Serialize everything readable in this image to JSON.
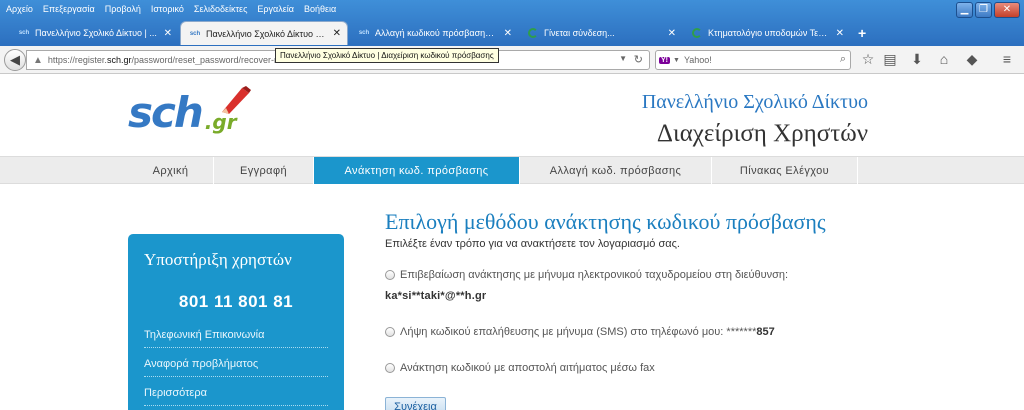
{
  "menubar": [
    "Αρχείο",
    "Επεξεργασία",
    "Προβολή",
    "Ιστορικό",
    "Σελιδοδείκτες",
    "Εργαλεία",
    "Βοήθεια"
  ],
  "window_controls": {
    "minimize": "▁",
    "maximize": "❐",
    "close": "✕"
  },
  "tabs": [
    {
      "title": "Πανελλήνιο Σχολικό Δίκτυο | ...",
      "favicon": "sch",
      "close": "✕"
    },
    {
      "title": "Πανελλήνιο Σχολικό Δίκτυο | ...",
      "favicon": "sch",
      "close": "✕"
    },
    {
      "title": "Αλλαγή κωδικού πρόσβασης - ...",
      "favicon": "sch",
      "close": "✕"
    },
    {
      "title": "Γίνεται σύνδεση...",
      "favicon": "loading-spinner",
      "close": "✕"
    },
    {
      "title": "Κτηματολόγιο υποδομών Τεχ...",
      "favicon": "loading-spinner",
      "close": "✕"
    }
  ],
  "new_tab": "+",
  "tooltip": "Πανελλήνιο Σχολικό Δίκτυο | Διαχείριση κωδικού πρόσβασης",
  "address_bar": {
    "prefix": "https://register.",
    "domain": "sch.gr",
    "suffix": "/password/reset_password/recover-m..."
  },
  "search_bar": {
    "engine": "Y!",
    "placeholder": "Yahoo!"
  },
  "site_header": {
    "logo_main": "sch",
    "logo_suffix": ".gr",
    "line1": "Πανελλήνιο Σχολικό Δίκτυο",
    "line2": "Διαχείριση Χρηστών"
  },
  "nav": [
    {
      "label": "Αρχική"
    },
    {
      "label": "Εγγραφή"
    },
    {
      "label": "Ανάκτηση κωδ. πρόσβασης",
      "active": true
    },
    {
      "label": "Αλλαγή κωδ. πρόσβασης"
    },
    {
      "label": "Πίνακας Ελέγχου"
    }
  ],
  "sidebar": {
    "title": "Υποστήριξη χρηστών",
    "phone": "801 11 801 81",
    "links": [
      "Τηλεφωνική Επικοινωνία",
      "Αναφορά προβλήματος",
      "Περισσότερα"
    ]
  },
  "content": {
    "title": "Επιλογή μεθόδου ανάκτησης κωδικού πρόσβασης",
    "subtitle": "Επιλέξτε έναν τρόπο για να ανακτήσετε τον λογαριασμό σας.",
    "options": [
      {
        "label": "Επιβεβαίωση ανάκτησης με μήνυμα ηλεκτρονικού ταχυδρομείου στη διεύθυνση:",
        "detail": "ka*si**taki*@**h.gr"
      },
      {
        "label": "Λήψη κωδικού επαλήθευσης με μήνυμα (SMS) στο τηλέφωνό μου: *******",
        "detail": "857"
      },
      {
        "label": "Ανάκτηση κωδικού με αποστολή αιτήματος μέσω fax"
      }
    ],
    "continue_label": "Συνέχεια"
  },
  "colors": {
    "accent": "#1b96cc",
    "title_blue": "#1b7fbf",
    "chrome_blue": "#2c6fbf"
  }
}
